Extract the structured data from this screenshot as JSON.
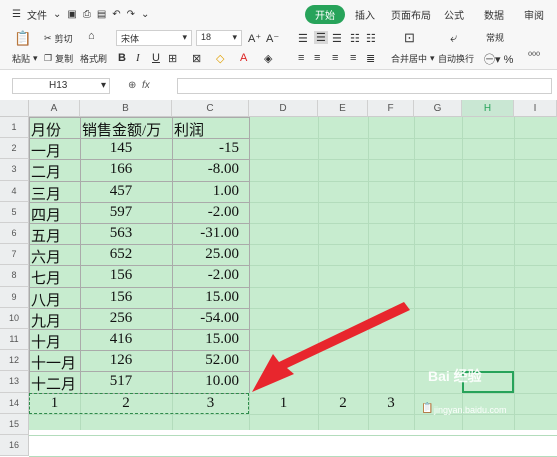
{
  "menubar": {
    "file_label": "文件",
    "tabs": [
      "开始",
      "插入",
      "页面布局",
      "公式",
      "数据",
      "审阅"
    ]
  },
  "ribbon": {
    "paste_label": "粘贴",
    "cut_label": "剪切",
    "copy_label": "复制",
    "format_painter_label": "格式刷",
    "font_name": "宋体",
    "font_size": "18",
    "merge_center_label": "合并居中",
    "wrap_text_label": "自动换行",
    "number_format": "常规"
  },
  "formula_bar": {
    "name_box": "H13",
    "fx_label": "fx",
    "value": ""
  },
  "sheet": {
    "columns": [
      "A",
      "B",
      "C",
      "D",
      "E",
      "F",
      "G",
      "H",
      "I"
    ],
    "selected_column": "H",
    "rows": [
      "1",
      "2",
      "3",
      "4",
      "5",
      "6",
      "7",
      "8",
      "9",
      "10",
      "11",
      "12",
      "13",
      "14",
      "15",
      "16"
    ],
    "table": [
      [
        "月份",
        "销售金额/万",
        "利润"
      ],
      [
        "一月",
        "145",
        "-15"
      ],
      [
        "二月",
        "166",
        "-8.00"
      ],
      [
        "三月",
        "457",
        "1.00"
      ],
      [
        "四月",
        "597",
        "-2.00"
      ],
      [
        "五月",
        "563",
        "-31.00"
      ],
      [
        "六月",
        "652",
        "25.00"
      ],
      [
        "七月",
        "156",
        "-2.00"
      ],
      [
        "八月",
        "156",
        "15.00"
      ],
      [
        "九月",
        "256",
        "-54.00"
      ],
      [
        "十月",
        "416",
        "15.00"
      ],
      [
        "十一月",
        "126",
        "52.00"
      ],
      [
        "十二月",
        "517",
        "10.00"
      ]
    ],
    "row14": [
      "1",
      "2",
      "3",
      "1",
      "2",
      "3"
    ],
    "active_cell": "H13"
  },
  "watermark": {
    "brand": "Bai 经验",
    "url": "jingyan.baidu.com"
  },
  "colors": {
    "accent": "#27a35a",
    "sheet_bg": "#c7eccf",
    "arrow": "#e8262d"
  }
}
